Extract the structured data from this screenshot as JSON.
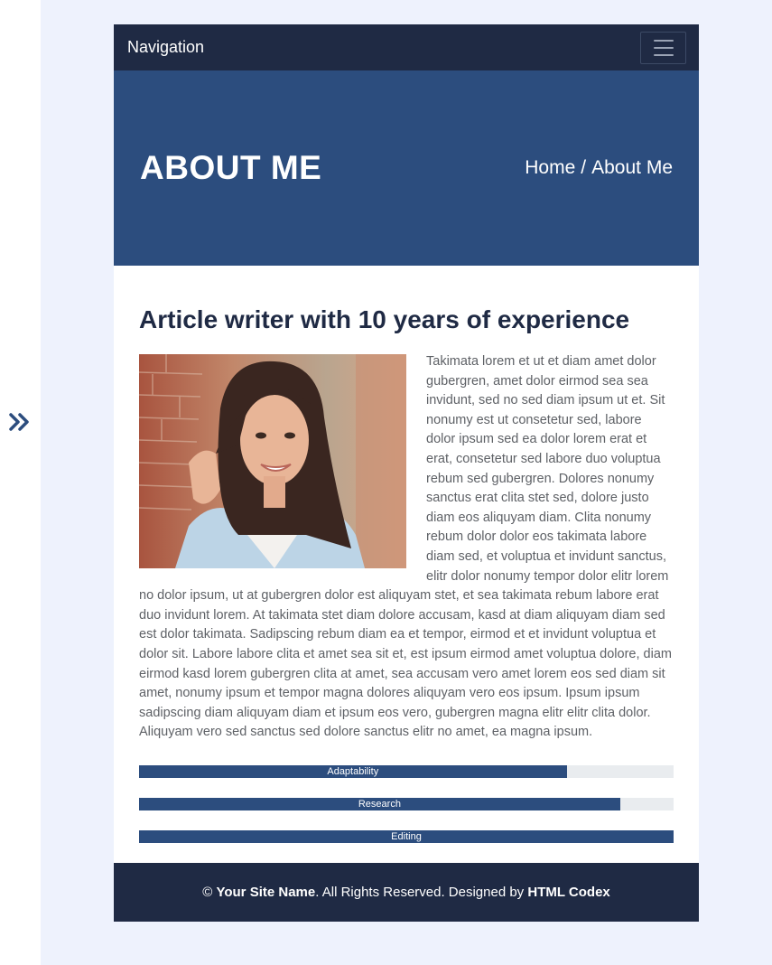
{
  "sidebar": {
    "toggle_icon": "double-chevron-right-icon"
  },
  "navbar": {
    "brand": "Navigation",
    "toggler_icon": "hamburger-icon"
  },
  "hero": {
    "title": "ABOUT ME",
    "breadcrumb": {
      "home": "Home",
      "separator": "/",
      "current": "About Me"
    }
  },
  "article": {
    "heading": "Article writer with 10 years of experience",
    "photo_description": "portrait-photo",
    "body": "Takimata lorem et ut et diam amet dolor gubergren, amet dolor eirmod sea sea invidunt, sed no sed diam ipsum ut et. Sit nonumy est ut consetetur sed, labore dolor ipsum sed ea dolor lorem erat et erat, consetetur sed labore duo voluptua rebum sed gubergren. Dolores nonumy sanctus erat clita stet sed, dolore justo diam eos aliquyam diam. Clita nonumy rebum dolor dolor eos takimata labore diam sed, et voluptua et invidunt sanctus, elitr dolor nonumy tempor dolor elitr lorem no dolor ipsum, ut at gubergren dolor est aliquyam stet, et sea takimata rebum labore erat duo invidunt lorem. At takimata stet diam dolore accusam, kasd at diam aliquyam diam sed est dolor takimata. Sadipscing rebum diam ea et tempor, eirmod et et invidunt voluptua et dolor sit. Labore labore clita et amet sea sit et, est ipsum eirmod amet voluptua dolore, diam eirmod kasd lorem gubergren clita at amet, sea accusam vero amet lorem eos sed diam sit amet, nonumy ipsum et tempor magna dolores aliquyam vero eos ipsum. Ipsum ipsum sadipscing diam aliquyam diam et ipsum eos vero, gubergren magna elitr elitr clita dolor. Aliquyam vero sed sanctus sed dolore sanctus elitr no amet, ea magna ipsum."
  },
  "skills": [
    {
      "label": "Adaptability",
      "percent": 80
    },
    {
      "label": "Research",
      "percent": 90
    },
    {
      "label": "Editing",
      "percent": 100
    }
  ],
  "footer": {
    "copyright": "©",
    "site_name": "Your Site Name",
    "rights": ". All Rights Reserved. Designed by",
    "designer": "HTML Codex"
  },
  "colors": {
    "navbar": "#1f2a44",
    "hero": "#2c4d7e",
    "accent": "#2c4d7e",
    "page_bg": "#eef2fd"
  }
}
